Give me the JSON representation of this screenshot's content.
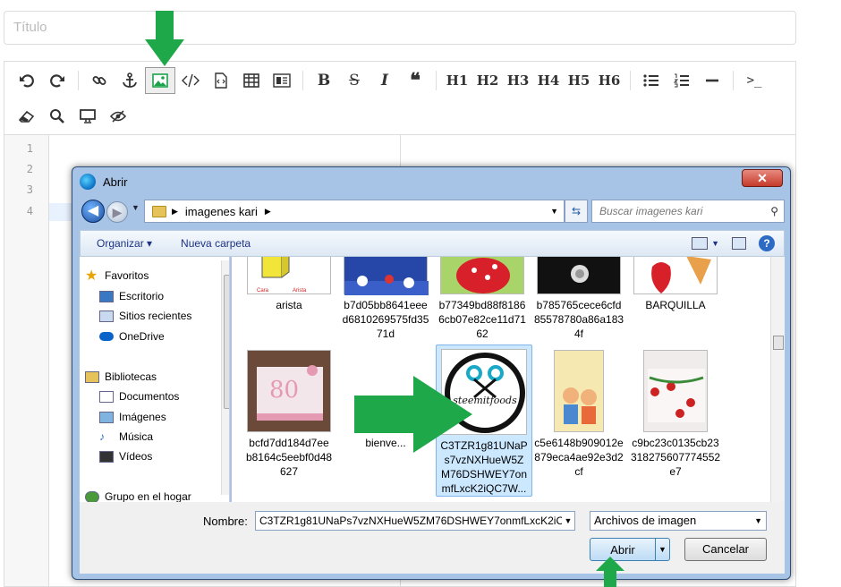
{
  "title_placeholder": "Título",
  "toolbar": {
    "headings": [
      "H1",
      "H2",
      "H3",
      "H4",
      "H5",
      "H6"
    ],
    "bold": "B",
    "strike": "S",
    "italic": "I",
    "quote": "❝",
    "terminal": ">_"
  },
  "editor": {
    "lines": [
      "1",
      "2",
      "3",
      "4"
    ]
  },
  "dialog": {
    "title": "Abrir",
    "close": "✕",
    "path_folder": "imagenes kari",
    "search_placeholder": "Buscar imagenes kari",
    "cmd_organize": "Organizar ▾",
    "cmd_new_folder": "Nueva carpeta",
    "nav": {
      "favorites": "Favoritos",
      "desktop": "Escritorio",
      "recent": "Sitios recientes",
      "onedrive": "OneDrive",
      "libraries": "Bibliotecas",
      "documents": "Documentos",
      "images": "Imágenes",
      "music": "Música",
      "videos": "Vídeos",
      "homegroup": "Grupo en el hogar"
    },
    "files_row1": [
      "arista",
      "b7d05bb8641eee d6810269575fd35 71d",
      "b77349bd88f8186 6cb07e82ce11d71 62",
      "b785765cece6cfd 85578780a86a183 4f",
      "BARQUILLA"
    ],
    "files_row2": [
      "bcfd7dd184d7ee b8164c5eebf0d48 627",
      "bienve...",
      "C3TZR1g81UNaP s7vzNXHueW5Z M76DSHWEY7on mfLxcK2iQC7W...",
      "c5e6148b909012e 879eca4ae92e3d2 cf",
      "c9bc23c0135cb23 318275607774552 e7"
    ],
    "steemit_label": "steemitfoods",
    "name_label": "Nombre:",
    "name_value": "C3TZR1g81UNaPs7vzNXHueW5ZM76DSHWEY7onmfLxcK2iC",
    "filter": "Archivos de imagen",
    "open": "Abrir",
    "cancel": "Cancelar"
  },
  "colors": {
    "arrow": "#1fa84a",
    "selection": "#cce8ff"
  }
}
